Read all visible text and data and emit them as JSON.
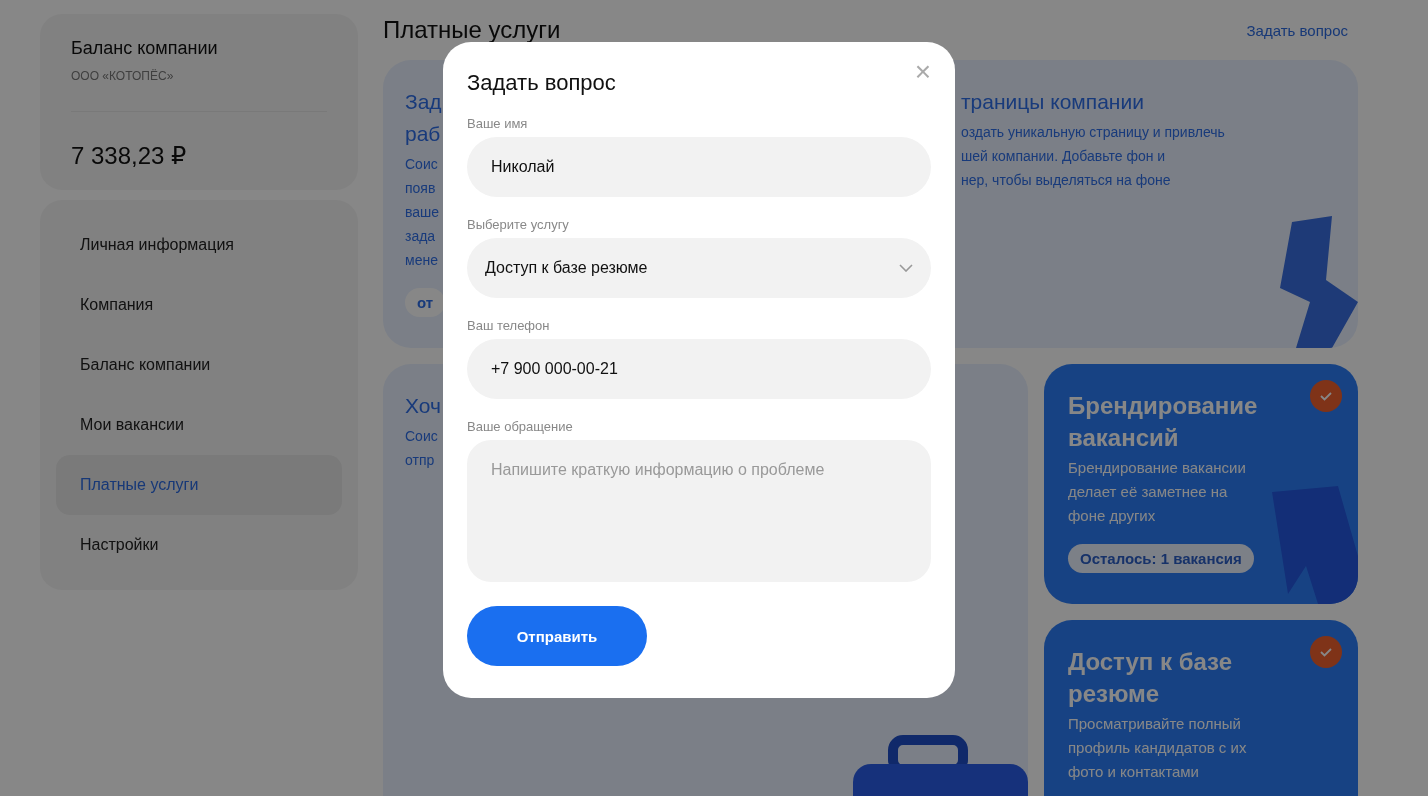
{
  "sidebar": {
    "balance": {
      "title": "Баланс компании",
      "company": "ООО «КОТОПЁС»",
      "amount": "7 338,23 ₽"
    },
    "nav": [
      {
        "label": "Личная информация",
        "selected": false
      },
      {
        "label": "Компания",
        "selected": false
      },
      {
        "label": "Баланс компании",
        "selected": false
      },
      {
        "label": "Мои вакансии",
        "selected": false
      },
      {
        "label": "Платные услуги",
        "selected": true
      },
      {
        "label": "Настройки",
        "selected": false
      }
    ]
  },
  "main": {
    "title": "Платные услуги",
    "ask_link": "Задать вопрос",
    "cards": [
      {
        "kind": "light",
        "title_lines": [
          "Зад",
          "раб"
        ],
        "text_lines": [
          "Соис",
          "появ",
          "ваше",
          "зада",
          "мене"
        ],
        "chip": "от"
      },
      {
        "kind": "light",
        "title_lines": [
          "траницы компании"
        ],
        "text_lines": [
          "оздать уникальную страницу и привлечь",
          "шей компании. Добавьте фон и",
          "нер, чтобы выделяться на фоне"
        ]
      },
      {
        "kind": "light",
        "title_lines": [
          "Хоч"
        ],
        "text_lines": [
          "Соис",
          "отпр"
        ]
      },
      {
        "kind": "blue",
        "title_lines": [
          "Брендирование",
          "вакансий"
        ],
        "text_lines": [
          "Брендирование вакансии",
          "делает её заметнее на",
          "фоне других"
        ],
        "chip": "Осталось: 1 вакансия",
        "active": true
      },
      {
        "kind": "blue",
        "title_lines": [
          "Доступ к базе",
          "резюме"
        ],
        "text_lines": [
          "Просматривайте полный",
          "профиль кандидатов с их",
          "фото и контактами"
        ],
        "active": true
      }
    ]
  },
  "modal": {
    "title": "Задать вопрос",
    "close": "×",
    "fields": [
      {
        "kind": "input",
        "label": "Ваше имя",
        "value": "Николай"
      },
      {
        "kind": "select",
        "label": "Выберите услугу",
        "value": "Доступ к базе резюме"
      },
      {
        "kind": "input",
        "label": "Ваш телефон",
        "value": "+7 900 000-00-21"
      },
      {
        "kind": "textarea",
        "label": "Ваше обращение",
        "placeholder": "Напишите краткую информацию о проблеме"
      }
    ],
    "submit": "Отправить"
  }
}
